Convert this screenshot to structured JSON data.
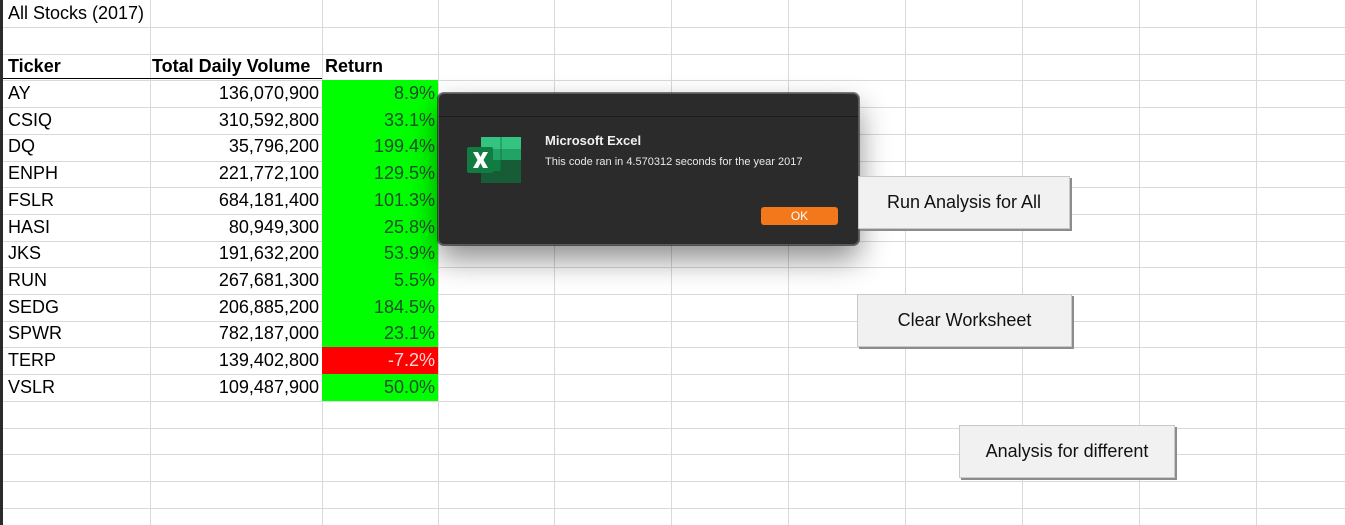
{
  "sheet": {
    "title": "All Stocks (2017)",
    "headers": {
      "ticker": "Ticker",
      "volume": "Total Daily Volume",
      "return": "Return"
    },
    "rows": [
      {
        "ticker": "AY",
        "volume": "136,070,900",
        "return": "8.9%",
        "return_value": 8.9,
        "positive": true
      },
      {
        "ticker": "CSIQ",
        "volume": "310,592,800",
        "return": "33.1%",
        "return_value": 33.1,
        "positive": true
      },
      {
        "ticker": "DQ",
        "volume": "35,796,200",
        "return": "199.4%",
        "return_value": 199.4,
        "positive": true
      },
      {
        "ticker": "ENPH",
        "volume": "221,772,100",
        "return": "129.5%",
        "return_value": 129.5,
        "positive": true
      },
      {
        "ticker": "FSLR",
        "volume": "684,181,400",
        "return": "101.3%",
        "return_value": 101.3,
        "positive": true
      },
      {
        "ticker": "HASI",
        "volume": "80,949,300",
        "return": "25.8%",
        "return_value": 25.8,
        "positive": true
      },
      {
        "ticker": "JKS",
        "volume": "191,632,200",
        "return": "53.9%",
        "return_value": 53.9,
        "positive": true
      },
      {
        "ticker": "RUN",
        "volume": "267,681,300",
        "return": "5.5%",
        "return_value": 5.5,
        "positive": true
      },
      {
        "ticker": "SEDG",
        "volume": "206,885,200",
        "return": "184.5%",
        "return_value": 184.5,
        "positive": true
      },
      {
        "ticker": "SPWR",
        "volume": "782,187,000",
        "return": "23.1%",
        "return_value": 23.1,
        "positive": true
      },
      {
        "ticker": "TERP",
        "volume": "139,402,800",
        "return": "-7.2%",
        "return_value": -7.2,
        "positive": false
      },
      {
        "ticker": "VSLR",
        "volume": "109,487,900",
        "return": "50.0%",
        "return_value": 50.0,
        "positive": true
      }
    ]
  },
  "dialog": {
    "title": "Microsoft Excel",
    "message": "This code ran in 4.570312 seconds for the year 2017",
    "ok_label": "OK",
    "icon": "excel-icon"
  },
  "buttons": {
    "run_all": "Run Analysis for All",
    "clear": "Clear Worksheet",
    "different": "Analysis for different"
  },
  "colors": {
    "positive_fill": "#00ff00",
    "negative_fill": "#ff0000",
    "gridline": "#d9d9d9",
    "dialog_bg": "#2b2b2b",
    "ok_button": "#f3781b",
    "excel_green": "#1f7244"
  }
}
